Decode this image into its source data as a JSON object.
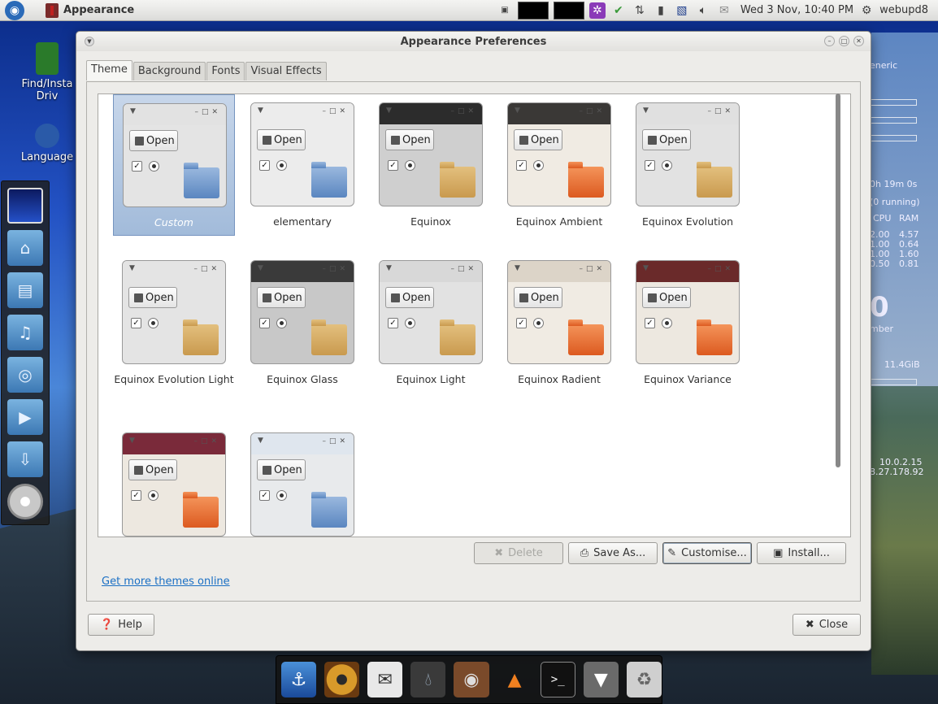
{
  "panel": {
    "app_title": "Appearance",
    "datetime": "Wed  3 Nov, 10:40 PM",
    "user": "webupd8"
  },
  "desktop": {
    "icons": [
      {
        "label": "Find/Insta Driv"
      },
      {
        "label": "Language"
      }
    ],
    "conky": {
      "generic": "eneric",
      "uptime": "0h 19m 0s",
      "running": "(0 running)",
      "cpu_header": "CPU",
      "ram_header": "RAM",
      "rows": [
        {
          "cpu": "2.00",
          "ram": "4.57"
        },
        {
          "cpu": "1.00",
          "ram": "0.64"
        },
        {
          "cpu": "1.00",
          "ram": "1.60"
        },
        {
          "cpu": "0.50",
          "ram": "0.81"
        }
      ],
      "big_digit": "0",
      "month_tail": "mber",
      "disk": "11.4GiB",
      "ip1": "10.0.2.15",
      "ip2": "8.27.178.92"
    }
  },
  "window": {
    "title": "Appearance Preferences",
    "tabs": [
      {
        "label": "Theme",
        "active": true
      },
      {
        "label": "Background",
        "active": false
      },
      {
        "label": "Fonts",
        "active": false
      },
      {
        "label": "Visual Effects",
        "active": false
      }
    ],
    "open_label": "Open",
    "themes": [
      {
        "name": "Custom",
        "selected": true,
        "header_color": "#e2e2e2",
        "body_color": "#e4e4e4",
        "folder": "blue"
      },
      {
        "name": "elementary",
        "selected": false,
        "header_color": "#ececec",
        "body_color": "#ececec",
        "folder": "blue"
      },
      {
        "name": "Equinox",
        "selected": false,
        "header_color": "#2c2c2c",
        "body_color": "#cfcfcf",
        "folder": "tan"
      },
      {
        "name": "Equinox Ambient",
        "selected": false,
        "header_color": "#3a3836",
        "body_color": "#f0ebe3",
        "folder": "orange"
      },
      {
        "name": "Equinox Evolution",
        "selected": false,
        "header_color": "#e0e0e0",
        "body_color": "#e2e2e2",
        "folder": "tan"
      },
      {
        "name": "Equinox Evolution Light",
        "selected": false,
        "header_color": "#e4e4e4",
        "body_color": "#e4e4e4",
        "folder": "tan"
      },
      {
        "name": "Equinox Glass",
        "selected": false,
        "header_color": "#3a3a3a",
        "body_color": "#c8c8c8",
        "folder": "tan"
      },
      {
        "name": "Equinox Light",
        "selected": false,
        "header_color": "#d8d8d8",
        "body_color": "#e2e2e2",
        "folder": "tan"
      },
      {
        "name": "Equinox Radient",
        "selected": false,
        "header_color": "#dcd4c8",
        "body_color": "#f0ebe3",
        "folder": "orange"
      },
      {
        "name": "Equinox Variance",
        "selected": false,
        "header_color": "#6a2a2a",
        "body_color": "#ede8e0",
        "folder": "orange"
      },
      {
        "name": "",
        "selected": false,
        "header_color": "#7a2a3a",
        "body_color": "#ede8e0",
        "folder": "orange"
      },
      {
        "name": "",
        "selected": false,
        "header_color": "#dfe6ee",
        "body_color": "#e8eaec",
        "folder": "blue"
      }
    ],
    "buttons": {
      "delete": "Delete",
      "save_as": "Save As...",
      "customise": "Customise...",
      "install": "Install...",
      "help": "Help",
      "close": "Close"
    },
    "link": "Get more themes online"
  }
}
